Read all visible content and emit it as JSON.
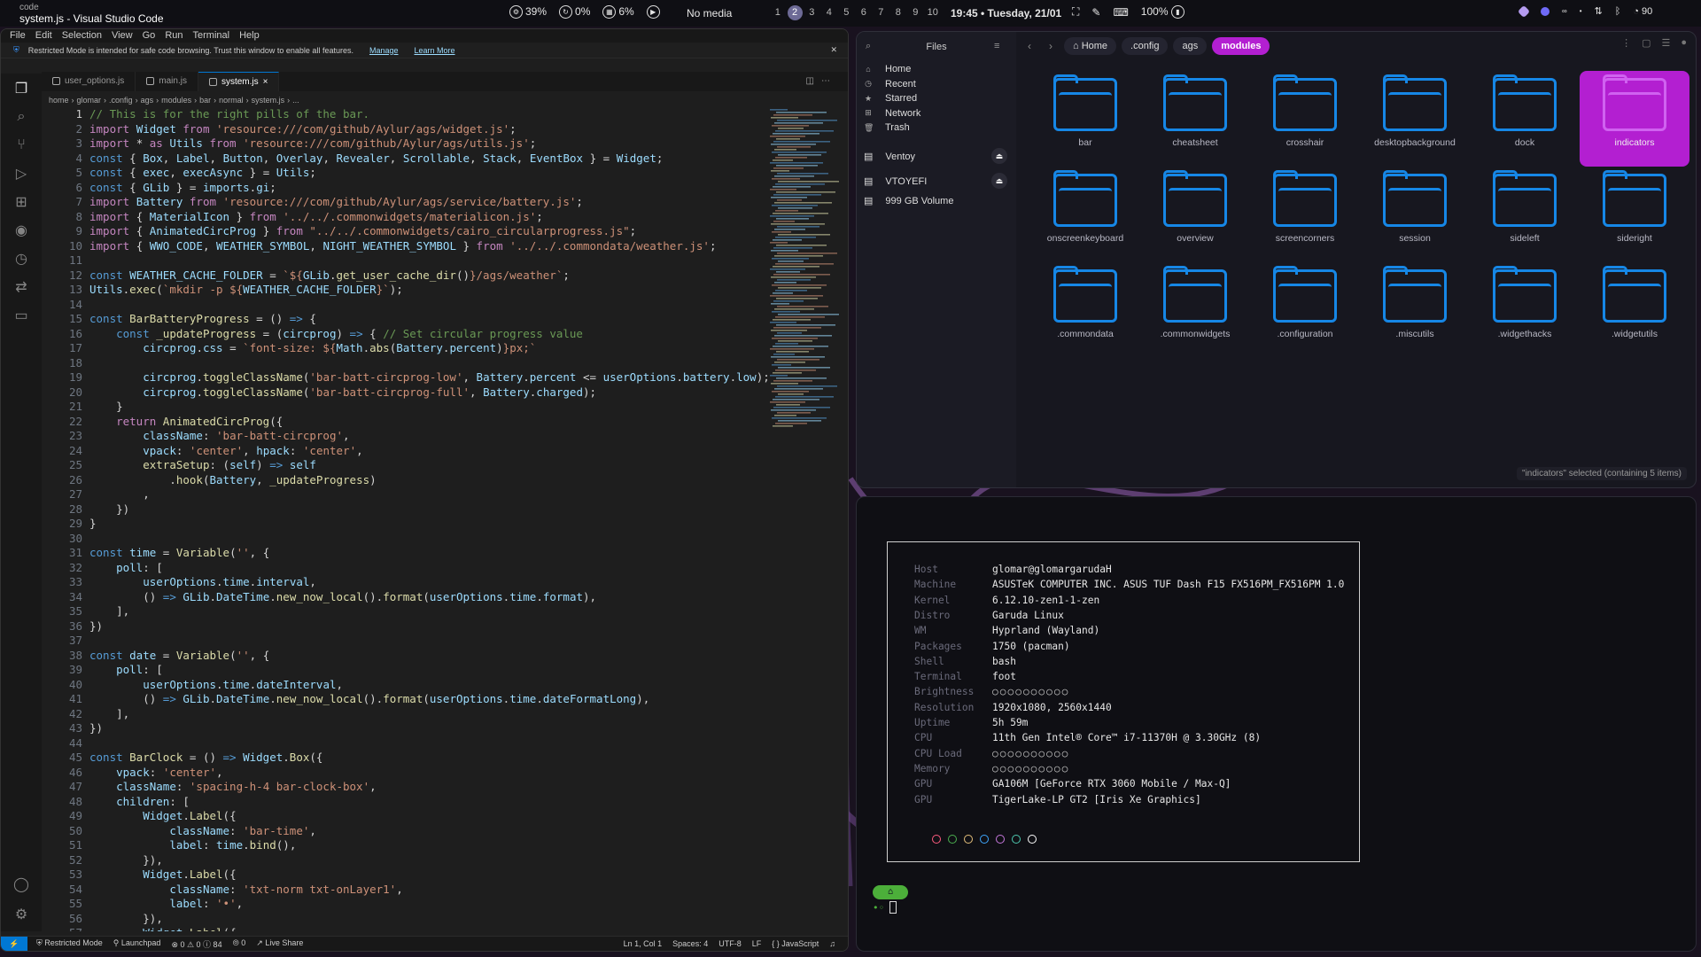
{
  "topbar": {
    "app": "code",
    "title": "system.js - Visual Studio Code",
    "cpu": "39%",
    "swap": "0%",
    "mem": "6%",
    "media": "No media",
    "workspaces": [
      "1",
      "2",
      "3",
      "4",
      "5",
      "6",
      "7",
      "8",
      "9",
      "10"
    ],
    "active_workspace": "2",
    "clock": "19:45 • Tuesday, 21/01",
    "battery": "100%",
    "right_battery": "90",
    "colors": {
      "tray1": "#b59cf0",
      "tray2": "#6f6af8"
    }
  },
  "vscode": {
    "menu": [
      "File",
      "Edit",
      "Selection",
      "View",
      "Go",
      "Run",
      "Terminal",
      "Help"
    ],
    "banner": {
      "text": "Restricted Mode is intended for safe code browsing. Trust this window to enable all features.",
      "manage": "Manage",
      "learn": "Learn More"
    },
    "tabs": [
      {
        "label": "user_options.js"
      },
      {
        "label": "main.js"
      },
      {
        "label": "system.js",
        "close": "×"
      }
    ],
    "breadcrumb": [
      "home",
      "glomar",
      ".config",
      "ags",
      "modules",
      "bar",
      "normal",
      "system.js",
      "..."
    ],
    "status": {
      "remote": "⚡",
      "mode": "Restricted Mode",
      "launchpad": "Launchpad",
      "problems": "⊗ 0 ⚠ 0 ⓘ 84",
      "ports": "⦾ 0",
      "liveshare": "Live Share",
      "position": "Ln 1, Col 1",
      "spaces": "Spaces: 4",
      "encoding": "UTF-8",
      "eol": "LF",
      "language": "{ } JavaScript"
    },
    "accent": "#0078d4"
  },
  "files": {
    "title": "Files",
    "places": [
      "Home",
      "Recent",
      "Starred",
      "Network",
      "Trash"
    ],
    "devices": [
      {
        "label": "Ventoy",
        "eject": true
      },
      {
        "label": "VTOYEFI",
        "eject": true
      },
      {
        "label": "999 GB Volume",
        "eject": false
      }
    ],
    "path": [
      "Home",
      ".config",
      "ags",
      "modules"
    ],
    "active_path": "modules",
    "folders": [
      "bar",
      "cheatsheet",
      "crosshair",
      "desktopbackground",
      "dock",
      "indicators",
      "onscreenkeyboard",
      "overview",
      "screencorners",
      "session",
      "sideleft",
      "sideright",
      ".commondata",
      ".commonwidgets",
      ".configuration",
      ".miscutils",
      ".widgethacks",
      ".widgetutils"
    ],
    "selected": "indicators",
    "status": "\"indicators\" selected (containing 5 items)",
    "accent": "#b31fd1",
    "folder_color": "#1687e6"
  },
  "terminal": {
    "fetch": [
      {
        "k": "Host",
        "v": "glomar@glomargarudaH"
      },
      {
        "k": "Machine",
        "v": "ASUSTeK COMPUTER INC. ASUS TUF Dash F15 FX516PM_FX516PM 1.0"
      },
      {
        "k": "Kernel",
        "v": "6.12.10-zen1-1-zen"
      },
      {
        "k": "Distro",
        "v": "Garuda Linux"
      },
      {
        "k": "WM",
        "v": "Hyprland (Wayland)"
      },
      {
        "k": "Packages",
        "v": "1750 (pacman)"
      },
      {
        "k": "Shell",
        "v": "bash"
      },
      {
        "k": "Terminal",
        "v": "foot"
      },
      {
        "k": "Brightness",
        "v": "○○○○○○○○○○"
      },
      {
        "k": "Resolution",
        "v": "1920x1080, 2560x1440"
      },
      {
        "k": "Uptime",
        "v": "5h 59m"
      },
      {
        "k": "CPU",
        "v": "11th Gen Intel® Core™ i7-11370H @ 3.30GHz (8)"
      },
      {
        "k": "CPU Load",
        "v": "○○○○○○○○○○"
      },
      {
        "k": "Memory",
        "v": "○○○○○○○○○○"
      },
      {
        "k": "GPU",
        "v": "GA106M [GeForce RTX 3060 Mobile / Max-Q]"
      },
      {
        "k": "GPU",
        "v": "TigerLake-LP GT2 [Iris Xe Graphics]"
      }
    ],
    "color_dots": [
      "#ff5b7f",
      "#4caf50",
      "#e5c07b",
      "#3fa7ff",
      "#c678dd",
      "#4ec9b0",
      "#ffffff"
    ],
    "prompt_icon": "⌂",
    "prompt_symbol": "•◦"
  }
}
